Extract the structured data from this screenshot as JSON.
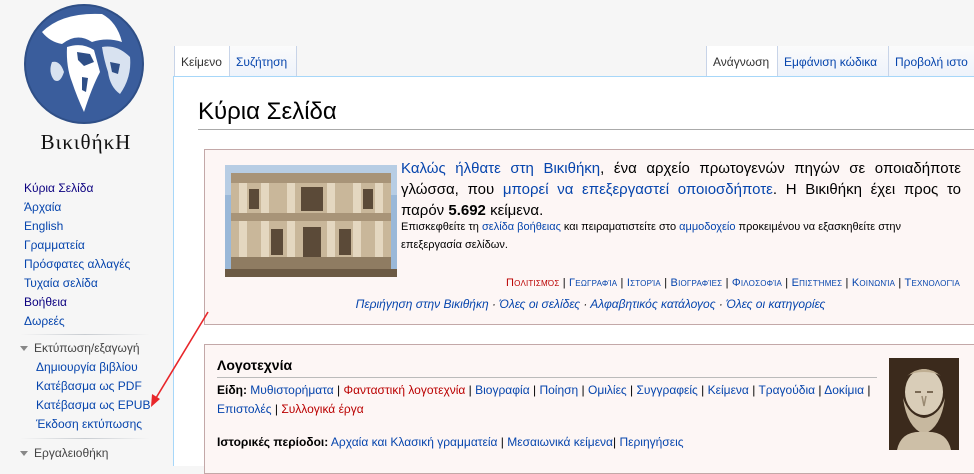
{
  "logo": {
    "wordmark": "ΒικιθήκΗ"
  },
  "sidebar": {
    "nav": [
      {
        "label": "Κύρια Σελίδα",
        "visited": true
      },
      {
        "label": "Άρχαία",
        "visited": false
      },
      {
        "label": "English",
        "visited": false
      },
      {
        "label": "Γραμματεία",
        "visited": false
      },
      {
        "label": "Πρόσφατες αλλαγές",
        "visited": false
      },
      {
        "label": "Τυχαία σελίδα",
        "visited": false
      },
      {
        "label": "Βοήθεια",
        "visited": true
      },
      {
        "label": "Δωρεές",
        "visited": false
      }
    ],
    "print_heading": "Εκτύπωση/εξαγωγή",
    "print_items": [
      {
        "label": "Δημιουργία βιβλίου"
      },
      {
        "label": "Κατέβασμα ως PDF"
      },
      {
        "label": "Κατέβασμα ως EPUB"
      },
      {
        "label": "Έκδοση εκτύπωσης"
      }
    ],
    "tools_heading": "Εργαλειοθήκη"
  },
  "tabs": {
    "left": [
      {
        "label": "Κείμενο",
        "selected": true
      },
      {
        "label": "Συζήτηση",
        "selected": false
      }
    ],
    "right": [
      {
        "label": "Ανάγνωση",
        "selected": true
      },
      {
        "label": "Εμφάνιση κώδικα",
        "selected": false
      },
      {
        "label": "Προβολή ιστο",
        "selected": false
      }
    ]
  },
  "page": {
    "title": "Κύρια Σελίδα"
  },
  "welcome": {
    "link1": "Καλώς ήλθατε στη Βικιθήκη",
    "text1": ", ένα αρχείο πρωτογενών πηγών σε οποιαδήποτε γλώσσα, που ",
    "link2": "μπορεί να επεξεργαστεί οποιοσδήποτε",
    "text2": ". Η Βικιθήκη έχει προς το παρόν ",
    "count": "5.692",
    "text3": " κείμενα.",
    "sub_a": "Επισκεφθείτε τη ",
    "sub_link1": "σελίδα βοήθειας",
    "sub_b": " και πειραματιστείτε στο ",
    "sub_link2": "αμμοδοχείο",
    "sub_c": " προκειμένου να εξασκηθείτε στην επεξεργασία σελίδων.",
    "categories": [
      {
        "label": "Πολιτισμός",
        "red": true
      },
      {
        "label": "Γεωγραφία",
        "red": false
      },
      {
        "label": "Ιστορία",
        "red": false
      },
      {
        "label": "Βιογραφίες",
        "red": false
      },
      {
        "label": "Φιλοσοφία",
        "red": false
      },
      {
        "label": "Επιστήμες",
        "red": false
      },
      {
        "label": "Κοινωνία",
        "red": false
      },
      {
        "label": "Τεχνολογία",
        "red": false
      }
    ],
    "browse": [
      "Περιήγηση στην Βικιθήκη",
      "Όλες οι σελίδες",
      "Αλφαβητικός κατάλογος",
      "Όλες οι κατηγορίες"
    ],
    "browse_sep": " · ",
    "cat_sep": " | "
  },
  "literature": {
    "title": "Λογοτεχνία",
    "genres_label": "Είδη:",
    "genres": [
      {
        "label": "Μυθιστορήματα",
        "red": false
      },
      {
        "label": "Φανταστική λογοτεχνία",
        "red": true
      },
      {
        "label": "Βιογραφία",
        "red": false
      },
      {
        "label": "Ποίηση",
        "red": false
      },
      {
        "label": "Ομιλίες",
        "red": false
      },
      {
        "label": "Συγγραφείς",
        "red": false
      },
      {
        "label": "Κείμενα",
        "red": false
      },
      {
        "label": "Τραγούδια",
        "red": false
      },
      {
        "label": "Δοκίμια",
        "red": false
      },
      {
        "label": "Επιστολές",
        "red": false
      },
      {
        "label": "Συλλογικά έργα",
        "red": true
      }
    ],
    "periods_label": "Ιστορικές περίοδοι:",
    "period1": "Αρχαία και Κλασική γραμματεία",
    "period2": "Μεσαιωνικά κείμενα",
    "period3": "Περιηγήσεις"
  },
  "colors": {
    "link": "#0645ad",
    "redlink": "#ba0000",
    "annotation_arrow": "#e8262a"
  }
}
